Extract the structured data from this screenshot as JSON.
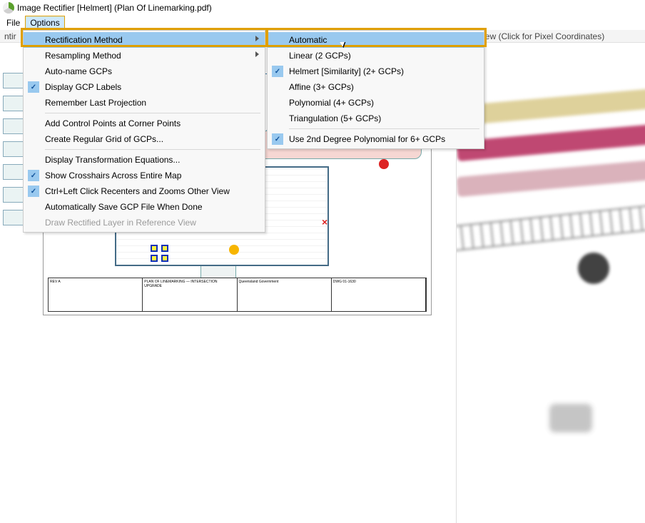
{
  "window": {
    "title": "Image Rectifier [Helmert] (Plan Of Linemarking.pdf)"
  },
  "menubar": {
    "file": "File",
    "options": "Options"
  },
  "left_header_partial": "ntir",
  "right_header": "ned View (Click for Pixel Coordinates)",
  "options_menu": {
    "rectification": "Rectification Method",
    "resampling": "Resampling Method",
    "auto_name": "Auto-name GCPs",
    "display_labels": "Display GCP Labels",
    "remember_proj": "Remember Last Projection",
    "add_corner": "Add Control Points at Corner Points",
    "create_grid": "Create Regular Grid of GCPs...",
    "disp_eq": "Display Transformation Equations...",
    "crosshairs": "Show Crosshairs Across Entire Map",
    "ctrl_left": "Ctrl+Left Click Recenters and Zooms Other View",
    "autosave": "Automatically Save GCP File When Done",
    "draw_ref": "Draw Rectified Layer in Reference View"
  },
  "rect_submenu": {
    "automatic": "Automatic",
    "linear": "Linear (2 GCPs)",
    "helmert": "Helmert [Similarity] (2+ GCPs)",
    "affine": "Affine (3+ GCPs)",
    "polynomial": "Polynomial (4+ GCPs)",
    "triang": "Triangulation (5+ GCPs)",
    "use2nd": "Use 2nd Degree Polynomial for 6+ GCPs"
  }
}
